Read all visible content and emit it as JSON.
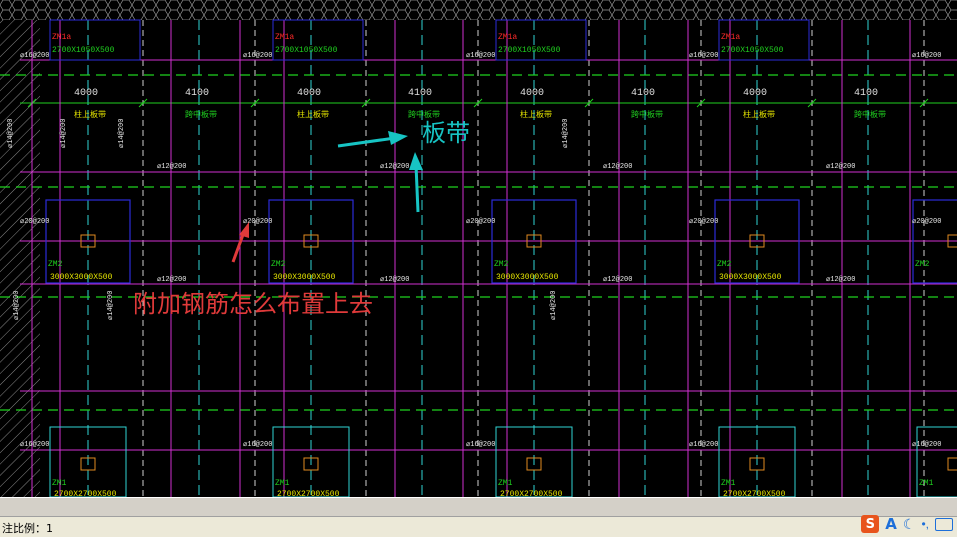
{
  "drawing": {
    "dimensions": [
      "4000",
      "4100",
      "4000",
      "4100",
      "4000",
      "4100",
      "4000",
      "4100"
    ],
    "strip_labels": [
      "柱上板带",
      "跨中板带",
      "柱上板带",
      "跨中板带",
      "柱上板带",
      "跨中板带",
      "柱上板带",
      "跨中板带"
    ],
    "cap_top_labels": [
      {
        "name": "ZM1a",
        "size": "2700X1050X500"
      },
      {
        "name": "ZM1a",
        "size": "2700X1050X500"
      },
      {
        "name": "ZM1a",
        "size": "2700X1050X500"
      },
      {
        "name": "ZM1a",
        "size": "2700X1050X500"
      }
    ],
    "cap_mid_labels": [
      {
        "name": "ZM2",
        "size": "3000X3000X500"
      },
      {
        "name": "ZM2",
        "size": "3000X3000X500"
      },
      {
        "name": "ZM2",
        "size": "3000X3000X500"
      },
      {
        "name": "ZM2",
        "size": "3000X3000X500"
      },
      {
        "name": "ZM2",
        "size": ""
      }
    ],
    "cap_bot_labels": [
      {
        "name": "ZM1",
        "size": "2700X2700X500"
      },
      {
        "name": "ZM1",
        "size": "2700X2700X500"
      },
      {
        "name": "ZM1",
        "size": "2700X2700X500"
      },
      {
        "name": "ZM1",
        "size": "2700X2700X500"
      },
      {
        "name": "ZM1",
        "size": ""
      }
    ],
    "rebar_labels": {
      "top": "⌀16@200",
      "mid": "⌀20@200",
      "bot": "⌀16@200",
      "span": "⌀12@200",
      "vertical": "⌀14@200"
    },
    "annotation_board_strip": "板带",
    "annotation_question": "附加钢筋怎么布置上去",
    "colors": {
      "grid_green": "#1fd11f",
      "axis_cyan": "#2fd5d5",
      "rebar_magenta": "#d12fd1",
      "cap_blue": "#2b2bd9",
      "text_yellow": "#e6e600",
      "text_red": "#ff2a2a",
      "annotation_cyan": "#17c4c4",
      "annotation_red": "#e03a3a"
    }
  },
  "status": {
    "scale_label": "注比例：1"
  },
  "ime": {
    "logo": "S",
    "mode": "A",
    "icons": [
      "sogou-logo-icon",
      "language-mode-icon",
      "half-moon-icon",
      "punctuation-icon",
      "keyboard-icon"
    ]
  }
}
